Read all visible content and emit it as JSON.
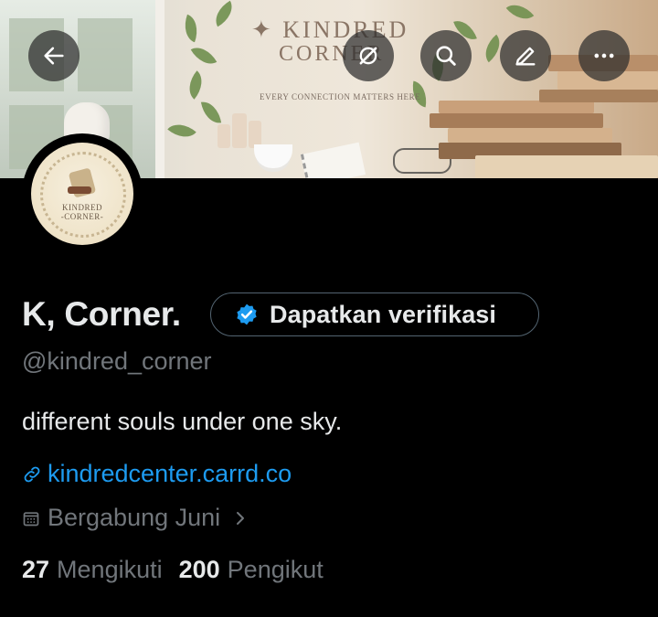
{
  "banner": {
    "title_line1": "✦ KINDRED",
    "title_line2": "CORNER",
    "tagline": "EVERY CONNECTION MATTERS HERE"
  },
  "top_bar": {
    "icons": [
      "back-arrow-icon",
      "no-retweet-icon",
      "search-icon",
      "edit-icon",
      "more-icon"
    ]
  },
  "avatar": {
    "label_line1": "KINDRED",
    "label_line2": "-CORNER-"
  },
  "profile": {
    "display_name": "K, Corner.",
    "verify_button_label": "Dapatkan verifikasi",
    "handle": "@kindred_corner",
    "bio": "different souls under one sky.",
    "website": "kindredcenter.carrd.co",
    "joined": "Bergabung Juni",
    "following_count": "27",
    "following_label": "Mengikuti",
    "followers_count": "200",
    "followers_label": "Pengikut"
  },
  "colors": {
    "background": "#000000",
    "text_primary": "#e7e9ea",
    "text_secondary": "#71767b",
    "link": "#1d9bf0",
    "verified_badge": "#1d9bf0",
    "button_border": "#536471"
  }
}
